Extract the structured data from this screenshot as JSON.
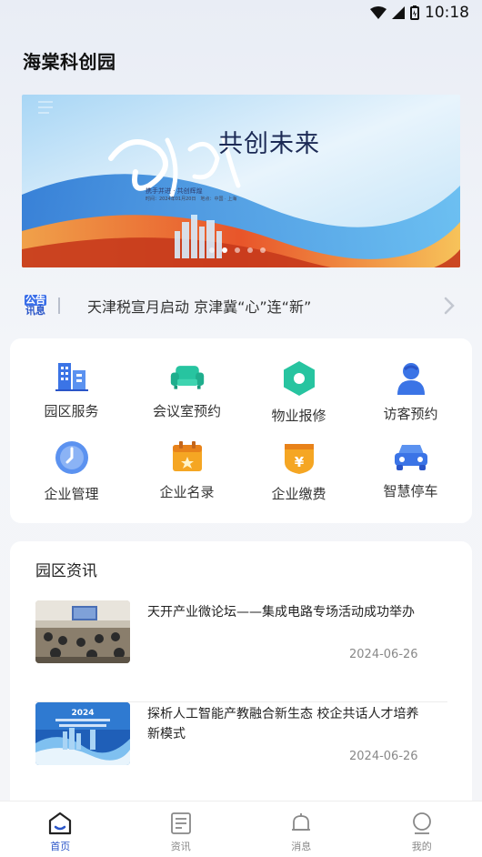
{
  "status": {
    "time": "10:18"
  },
  "app": {
    "title": "海棠科创园"
  },
  "banner": {
    "headline": "共创未来",
    "script_text": "加油2024",
    "subline": "携手并进 · 共创辉煌",
    "detail": "时间：2024年01月20日　地点：中国 · 上海",
    "slides": 5,
    "active_slide": 1
  },
  "notice": {
    "badge_top": "公告",
    "badge_bottom": "讯息",
    "text": "天津税宣月启动 京津冀“心”连“新”"
  },
  "services": [
    {
      "label": "园区服务",
      "icon": "buildings-icon"
    },
    {
      "label": "会议室预约",
      "icon": "sofa-icon"
    },
    {
      "label": "物业报修",
      "icon": "hexagon-repair-icon"
    },
    {
      "label": "访客预约",
      "icon": "person-icon"
    },
    {
      "label": "企业管理",
      "icon": "clock-icon"
    },
    {
      "label": "企业名录",
      "icon": "calendar-icon"
    },
    {
      "label": "企业缴费",
      "icon": "yen-shield-icon"
    },
    {
      "label": "智慧停车",
      "icon": "car-icon"
    }
  ],
  "news": {
    "section_title": "园区资讯",
    "items": [
      {
        "headline": "天开产业微论坛——集成电路专场活动成功举办",
        "date": "2024-06-26",
        "thumb": "meeting-photo"
      },
      {
        "headline": "探析人工智能产教融合新生态 校企共话人才培养新模式",
        "date": "2024-06-26",
        "thumb": "city-banner-photo"
      }
    ]
  },
  "tabs": [
    {
      "label": "首页",
      "icon": "home-icon",
      "active": true
    },
    {
      "label": "资讯",
      "icon": "document-icon",
      "active": false
    },
    {
      "label": "消息",
      "icon": "bell-icon",
      "active": false
    },
    {
      "label": "我的",
      "icon": "user-icon",
      "active": false
    }
  ],
  "colors": {
    "accent": "#2a55c8",
    "teal": "#27c4a0",
    "orange": "#f5a623"
  }
}
